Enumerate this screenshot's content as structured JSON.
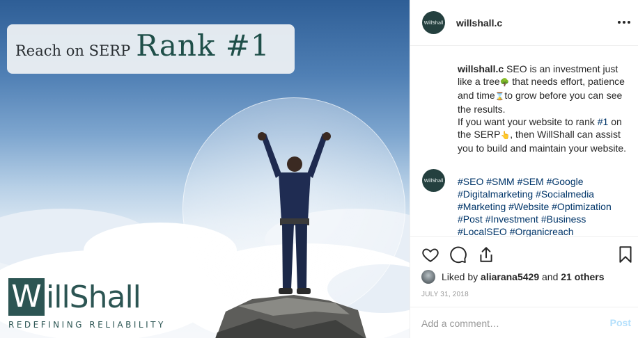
{
  "post_image": {
    "headline_small": "Reach on SERP",
    "headline_big": "Rank #1",
    "brand_initial": "W",
    "brand_rest": "illShall",
    "brand_tagline": "REDEFINING RELIABILITY"
  },
  "header": {
    "username": "willshall.c",
    "avatar_mark": "WillShall"
  },
  "caption": {
    "username": "willshall.c",
    "part1": " SEO is an investment just like a tree",
    "tree_emoji": "🌳",
    "part2": " that needs effort, patience and time",
    "hourglass_emoji": "⌛",
    "part3": "to grow before you can see the results.",
    "part4": "If you want your website to rank ",
    "rank_tag": "#1",
    "part5": " on the SERP",
    "pointer_emoji": "👆",
    "part6": ", then WillShall can assist you to build and maintain your website."
  },
  "hashtags": {
    "line1": "#SEO #SMM #SEM #Google",
    "line2": "#Digitalmarketing #Socialmedia",
    "line3": "#Marketing #Website #Optimization",
    "line4": "#Post #Investment #Business",
    "line5": "#LocalSEO #Organicreach"
  },
  "likes": {
    "prefix": "Liked by ",
    "user": "aliarana5429",
    "middle": " and ",
    "others": "21 others"
  },
  "date": "JULY 31, 2018",
  "comment_box": {
    "placeholder": "Add a comment…",
    "post_label": "Post"
  },
  "colors": {
    "link": "#003569",
    "brand_teal": "#2c5553",
    "post_disabled": "#b2dffc"
  }
}
